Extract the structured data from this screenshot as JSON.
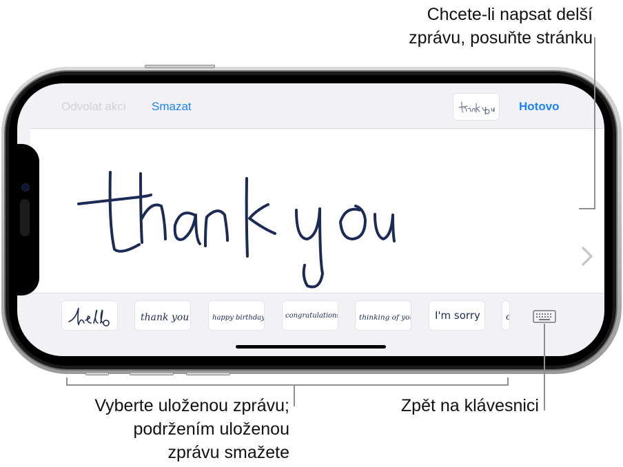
{
  "callouts": {
    "scroll_hint": [
      "Chcete-li napsat delší",
      "zprávu, posuňte stránku"
    ],
    "saved_message_hint": [
      "Vyberte uloženou zprávu;",
      "podržením uloženou",
      "zprávu smažete"
    ],
    "keyboard_hint": [
      "Zpět na klávesnici"
    ]
  },
  "toolbar": {
    "undo_label": "Odvolat akci",
    "clear_label": "Smazat",
    "done_label": "Hotovo",
    "preview_text": "thank you"
  },
  "canvas": {
    "handwritten_text": "thank you",
    "next_icon": "chevron-right-icon"
  },
  "saved_messages": [
    {
      "text": "hello"
    },
    {
      "text": "thank you"
    },
    {
      "text": "happy birthday"
    },
    {
      "text": "congratulations"
    },
    {
      "text": "thinking of you"
    },
    {
      "text": "I'm sorry"
    },
    {
      "text": "c"
    }
  ],
  "keyboard_button": {
    "icon": "keyboard-icon"
  },
  "colors": {
    "accent": "#1a82fb",
    "ink": "#1c2b55",
    "disabled": "#d2d2d6"
  }
}
